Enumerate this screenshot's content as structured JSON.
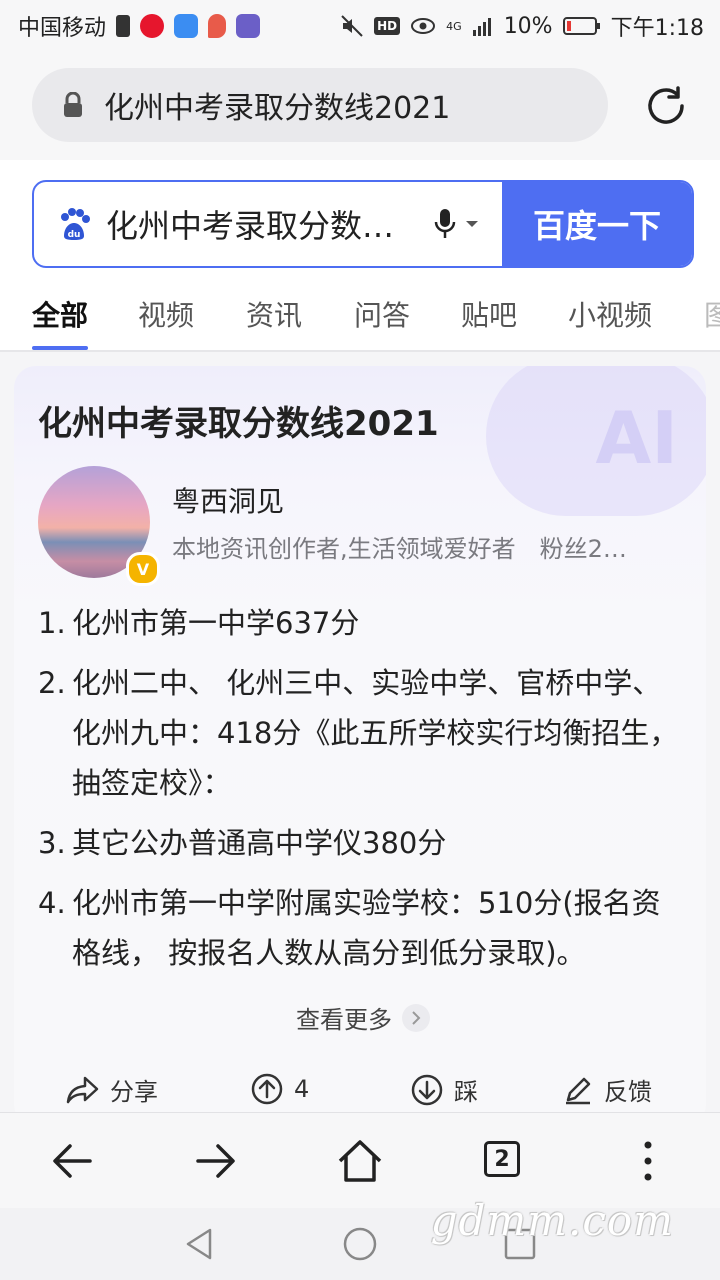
{
  "status_bar": {
    "carrier": "中国移动",
    "network": "4G",
    "battery": "10%",
    "time": "下午1:18"
  },
  "address_bar": {
    "url_text": "化州中考录取分数线2021"
  },
  "search": {
    "query": "化州中考录取分数线2021",
    "button_label": "百度一下"
  },
  "tabs": [
    {
      "label": "全部",
      "active": true
    },
    {
      "label": "视频"
    },
    {
      "label": "资讯"
    },
    {
      "label": "问答"
    },
    {
      "label": "贴吧"
    },
    {
      "label": "小视频"
    },
    {
      "label": "图"
    }
  ],
  "card": {
    "title": "化州中考录取分数线2021",
    "author": {
      "name": "粤西洞见",
      "desc": "本地资讯创作者,生活领域爱好者　粉丝2…",
      "badge": "V"
    },
    "ai_mark": "AI",
    "answers": [
      {
        "num": "1.",
        "text": "化州市第一中学637分"
      },
      {
        "num": "2.",
        "text": "化州二中、 化州三中、实验中学、官桥中学、化州九中：418分《此五所学校实行均衡招生，抽签定校》："
      },
      {
        "num": "3.",
        "text": "其它公办普通高中学仪380分"
      },
      {
        "num": "4.",
        "text": "化州市第一中学附属实验学校：510分(报名资格线， 按报名人数从高分到低分录取)。"
      }
    ],
    "more_label": "查看更多",
    "actions": {
      "share": "分享",
      "upvote_count": "4",
      "downvote": "踩",
      "feedback": "反馈"
    }
  },
  "browser_bar": {
    "tab_count": "2"
  },
  "watermark": "gdmm.com"
}
